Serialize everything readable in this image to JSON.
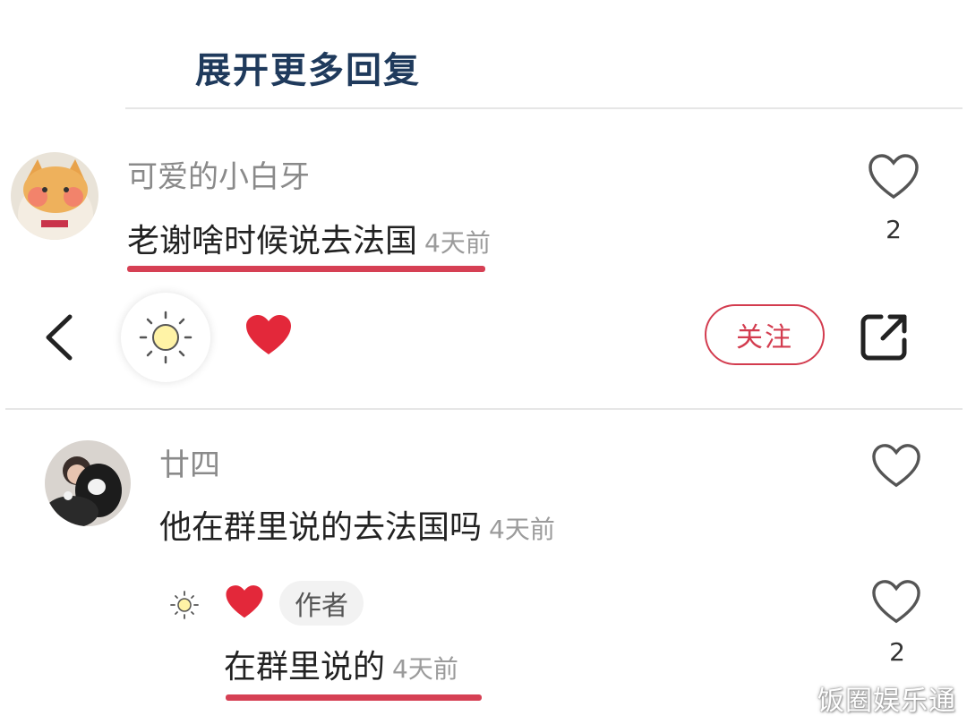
{
  "replies": {
    "expand_label": "展开更多回复"
  },
  "comments": [
    {
      "user": "可爱的小白牙",
      "text": "老谢啥时候说去法国",
      "time": "4天前",
      "likes": "2"
    },
    {
      "user": "廿四",
      "text": "他在群里说的去法国吗",
      "time": "4天前",
      "likes": ""
    }
  ],
  "author_reply": {
    "badge": "作者",
    "text": "在群里说的",
    "time": "4天前",
    "likes": "2"
  },
  "toolbar": {
    "follow_label": "关注"
  },
  "watermark": "饭圈娱乐通",
  "colors": {
    "accent": "#d33c4f",
    "underline": "#d64054",
    "link": "#1f3a5c",
    "heart": "#e3283a"
  }
}
